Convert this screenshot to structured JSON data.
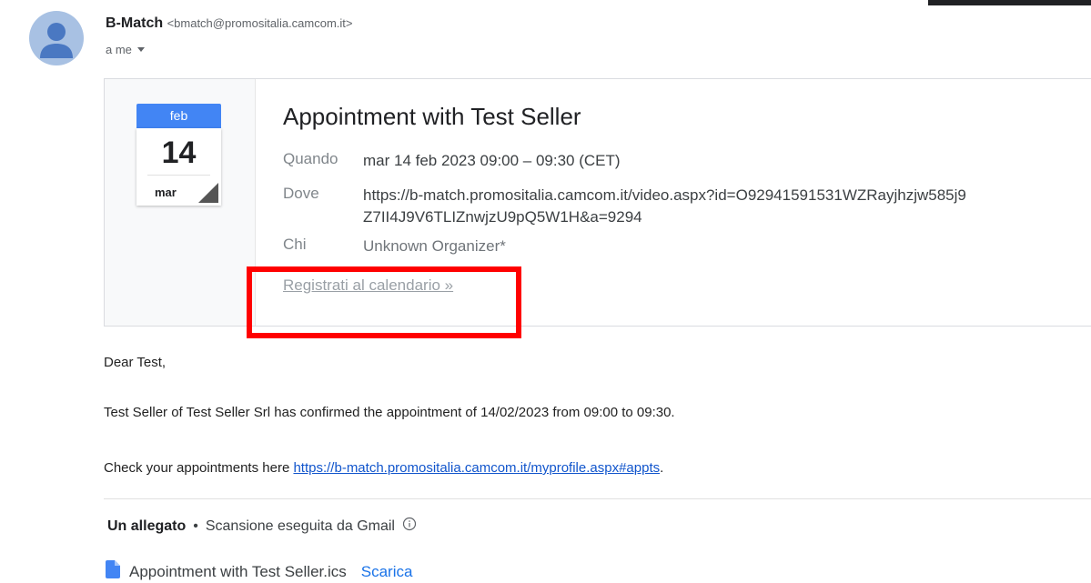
{
  "sender": {
    "name": "B-Match",
    "email": "<bmatch@promositalia.camcom.it>",
    "recipient": "a me"
  },
  "invite": {
    "calendar": {
      "month": "feb",
      "day": "14",
      "weekday": "mar"
    },
    "title": "Appointment with Test Seller",
    "when_label": "Quando",
    "when_value": "mar 14 feb 2023 09:00 – 09:30 (CET)",
    "where_label": "Dove",
    "where_line1": "https://b-match.promositalia.camcom.it/video.aspx?id=O92941591531WZRayjhzjw585j9",
    "where_line2": "Z7II4J9V6TLIZnwjzU9pQ5W1H&a=9294",
    "who_label": "Chi",
    "who_value": "Unknown Organizer*",
    "register_link": "Registrati al calendario »"
  },
  "body": {
    "greeting": "Dear Test,",
    "confirmation": "Test Seller of Test Seller Srl has confirmed the appointment of 14/02/2023 from 09:00 to 09:30.",
    "check_prefix": "Check your appointments here ",
    "check_link": "https://b-match.promositalia.camcom.it/myprofile.aspx#appts",
    "check_suffix": "."
  },
  "attachments": {
    "count_label": "Un allegato",
    "separator": "•",
    "scan_text": "Scansione eseguita da Gmail",
    "file_name": "Appointment with Test Seller.ics",
    "download_label": "Scarica"
  },
  "colors": {
    "highlight": "#ff0000",
    "calendar_header": "#4285f4",
    "link": "#1155cc"
  }
}
